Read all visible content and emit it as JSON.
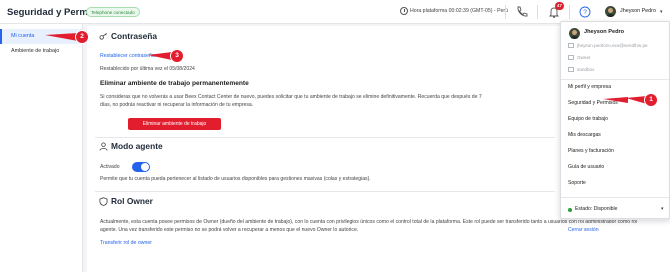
{
  "topbar": {
    "title": "Seguridad y Permisos",
    "status_badge": "Telephone conectado",
    "platform_time": "Hora plataforma 00:02:39 (GMT-05) - Perú",
    "notifications_count": "47",
    "user_name": "Jheyson Pedro",
    "icons": [
      "clock-icon",
      "phone-icon",
      "bell-icon",
      "help-icon",
      "chevron-down-icon"
    ]
  },
  "sidebar": {
    "items": [
      {
        "label": "Mi cuenta",
        "active": true
      },
      {
        "label": "Ambiente de trabajo",
        "active": false
      }
    ]
  },
  "password": {
    "heading": "Contraseña",
    "reset_link": "Restablecer contraseña",
    "last_reset": "Restablecido por última vez el 05/08/2024"
  },
  "delete_env": {
    "heading": "Eliminar ambiente de trabajo permanentemente",
    "desc_line1": "Si consideras que no volverás a usar Beex Contact Center de nuevo, puedes solicitar que tu ambiente de trabajo se elimine definitivamente. Recuerda que después de 7",
    "desc_line2": "días, no podrás reactivar ni recuperar la información de tu empresa.",
    "button": "Eliminar ambiente de trabajo"
  },
  "agent_mode": {
    "heading": "Modo agente",
    "toggle_label": "Activado",
    "toggle_on": true,
    "desc": "Permite que tu cuenta pueda pertenecer al listado de usuarios disponibles para gestiones masivas (colas y estrategias)."
  },
  "owner_role": {
    "heading": "Rol Owner",
    "desc_line1": "Actualmente, esta cuenta posee permisos de Owner (dueño del ambiente de trabajo), con lo cuenta con privilegios únicos como el control total de la plataforma. Este rol puede ser transferido tanto a usuarios con rol administrador como rol",
    "desc_line2": "agente. Una vez transferido este permiso no se podrá volver a recuperar a menos que el nuevo Owner lo autorice.",
    "transfer_link": "Transferir rol de owner"
  },
  "user_menu": {
    "name": "Jheyson Pedro",
    "email": "jheyson.pedrozo.exe@sendthis.pe",
    "role": "Owner",
    "environment": "sandbox",
    "items": [
      "Mi perfil y empresa",
      "Seguridad y Permisos",
      "Equipo de trabajo",
      "Mis descargas",
      "Planes y facturación",
      "Guía de usuario",
      "Soporte"
    ],
    "status": "Estado: Disponible",
    "status_color": "#2e9d3f",
    "logout": "Cerrar sesión"
  },
  "markers": [
    "1",
    "2",
    "3"
  ],
  "colors": {
    "accent": "#2563eb",
    "danger": "#e11d2e",
    "success": "#2e8b42"
  }
}
